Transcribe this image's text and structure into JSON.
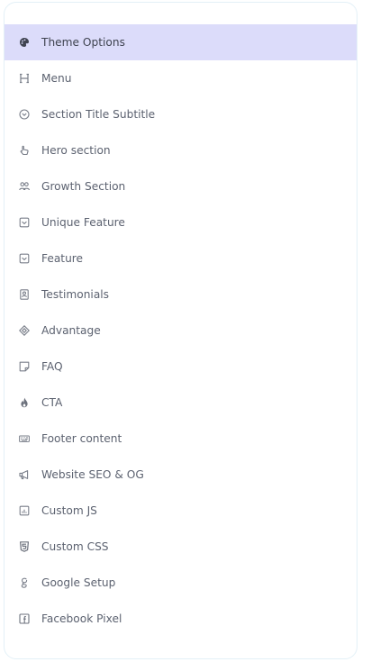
{
  "sidebar": {
    "items": [
      {
        "label": "Theme Options",
        "icon": "palette-icon",
        "active": true
      },
      {
        "label": "Menu",
        "icon": "heading-icon",
        "active": false
      },
      {
        "label": "Section Title Subtitle",
        "icon": "chevron-circle-icon",
        "active": false
      },
      {
        "label": "Hero section",
        "icon": "pointer-hand-icon",
        "active": false
      },
      {
        "label": "Growth Section",
        "icon": "users-icon",
        "active": false
      },
      {
        "label": "Unique Feature",
        "icon": "checkbox-icon",
        "active": false
      },
      {
        "label": "Feature",
        "icon": "checkbox-icon",
        "active": false
      },
      {
        "label": "Testimonials",
        "icon": "contact-card-icon",
        "active": false
      },
      {
        "label": "Advantage",
        "icon": "diamond-icon",
        "active": false
      },
      {
        "label": "FAQ",
        "icon": "note-icon",
        "active": false
      },
      {
        "label": "CTA",
        "icon": "flame-icon",
        "active": false
      },
      {
        "label": "Footer content",
        "icon": "keyboard-icon",
        "active": false
      },
      {
        "label": "Website SEO & OG",
        "icon": "megaphone-icon",
        "active": false
      },
      {
        "label": "Custom JS",
        "icon": "chart-box-icon",
        "active": false
      },
      {
        "label": "Custom CSS",
        "icon": "css-shield-icon",
        "active": false
      },
      {
        "label": "Google Setup",
        "icon": "google-g-icon",
        "active": false
      },
      {
        "label": "Facebook Pixel",
        "icon": "facebook-icon",
        "active": false
      }
    ]
  },
  "colors": {
    "active_background": "#dcdcfa",
    "text": "#5c6270",
    "icon": "#7a7f8a",
    "border": "#e3f0f7"
  }
}
